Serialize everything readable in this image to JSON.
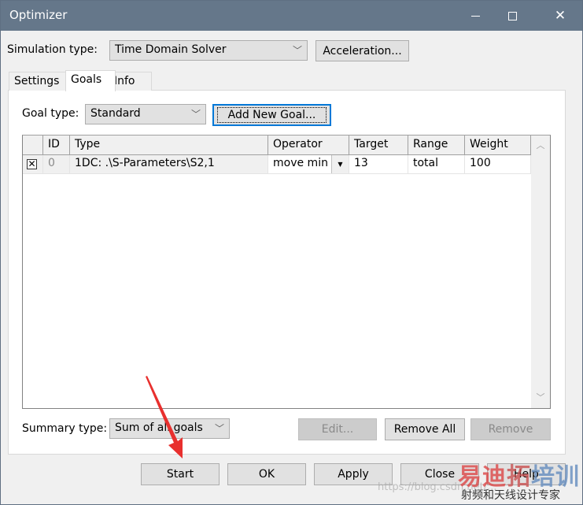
{
  "window": {
    "title": "Optimizer",
    "controls": {
      "minimize": "minimize-icon",
      "maximize": "maximize-icon",
      "close": "close-icon",
      "close_glyph": "✕"
    }
  },
  "simulation": {
    "label": "Simulation type:",
    "value": "Time Domain Solver",
    "acceleration_button": "Acceleration..."
  },
  "tabs": [
    {
      "label": "Settings",
      "active": false
    },
    {
      "label": "Goals",
      "active": true
    },
    {
      "label": "Info",
      "active": false
    }
  ],
  "goals": {
    "goal_type_label": "Goal type:",
    "goal_type_value": "Standard",
    "add_goal_button": "Add New Goal...",
    "table": {
      "columns": [
        "",
        "ID",
        "Type",
        "Operator",
        "Target",
        "Range",
        "Weight"
      ],
      "rows": [
        {
          "checked": true,
          "check_glyph": "✕",
          "id": "0",
          "type": "1DC: .\\S-Parameters\\S2,1",
          "operator": "move min",
          "target": "13",
          "range": "total",
          "weight": "100"
        }
      ]
    },
    "summary_type_label": "Summary type:",
    "summary_type_value": "Sum of all goals",
    "edit_button": "Edit...",
    "remove_all_button": "Remove All",
    "remove_button": "Remove"
  },
  "footer": {
    "start": "Start",
    "ok": "OK",
    "apply": "Apply",
    "close": "Close",
    "help": "Help"
  },
  "glyphs": {
    "chevron_down": "﹀",
    "scroll_up": "︿",
    "scroll_down": "﹀",
    "dropdown_arrow": "▼"
  },
  "annotation": {
    "arrow_color": "#e8302e"
  },
  "watermark": {
    "brand_red": "易迪",
    "brand_mid": "拓",
    "brand_blue": "培训",
    "tagline": "射频和天线设计专家",
    "url": "https://blog.csdn.net/..."
  }
}
